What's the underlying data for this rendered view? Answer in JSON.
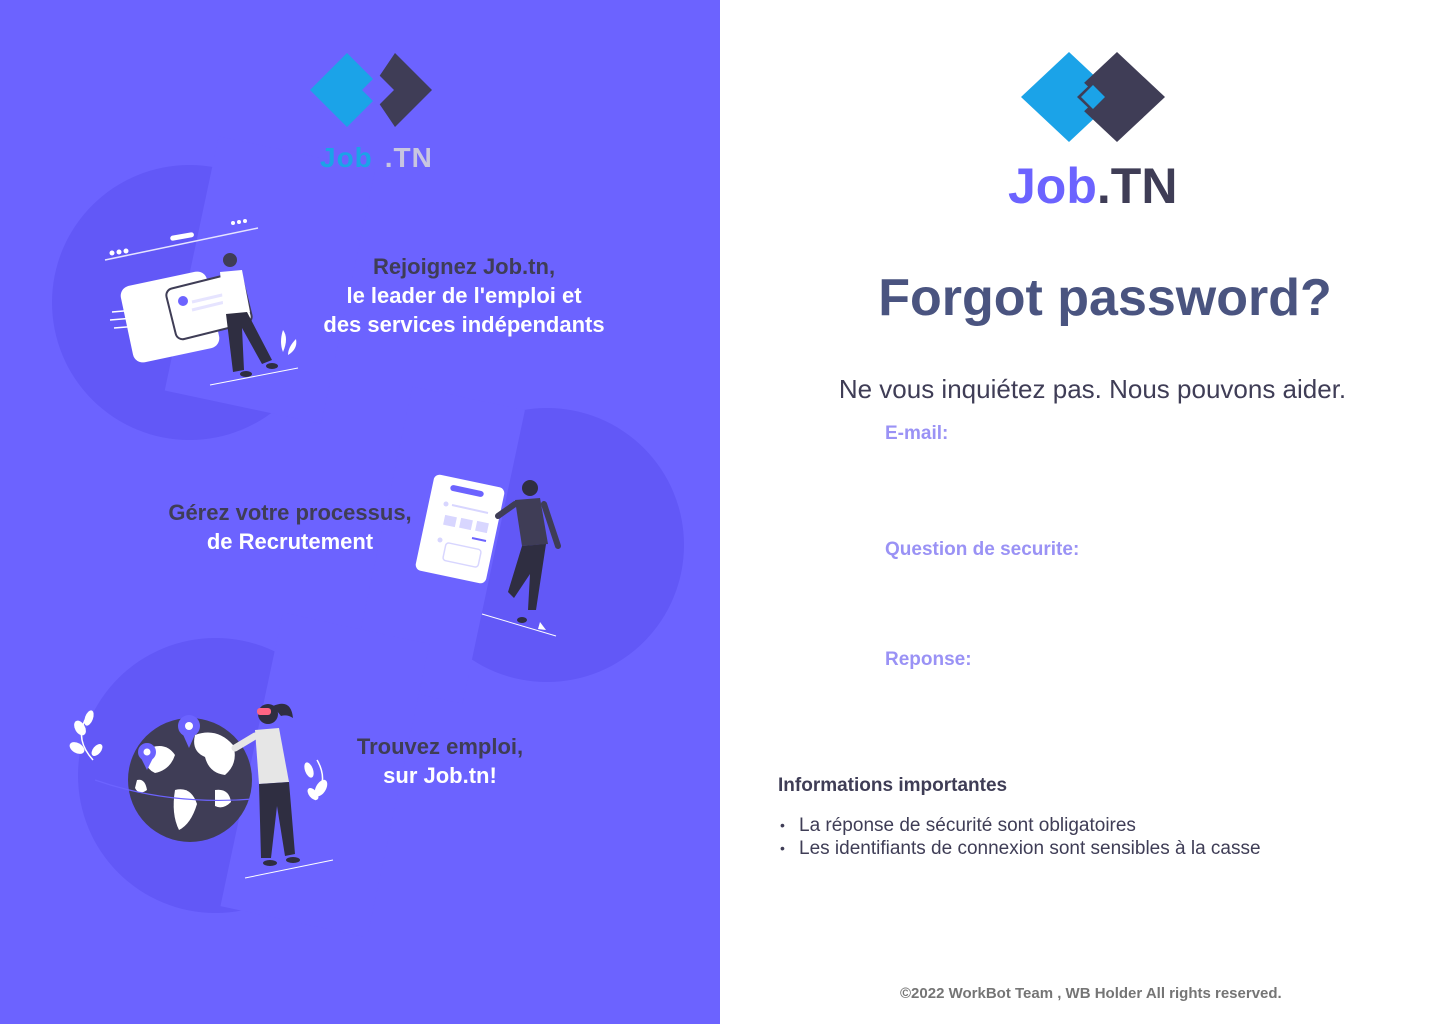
{
  "brand": {
    "name_part1": "Job",
    "name_part2": ".TN",
    "colors": {
      "accent": "#6c63ff",
      "blue": "#1ba3e8",
      "dark": "#3f3d56"
    }
  },
  "left_panel": {
    "features": [
      {
        "line1": "Rejoignez Job.tn,",
        "line2": "le leader de l'emploi et",
        "line3": "des services indépendants"
      },
      {
        "line1": "Gérez votre processus,",
        "line2": "de Recrutement"
      },
      {
        "line1": "Trouvez emploi,",
        "line2": "sur Job.tn!"
      }
    ]
  },
  "form": {
    "title": "Forgot password?",
    "subtitle": "Ne vous inquiétez pas. Nous pouvons aider.",
    "email_label": "E-mail:",
    "email_value": "",
    "question_label": "Question de securite:",
    "question_value": "",
    "answer_label": "Reponse:",
    "answer_value": ""
  },
  "info": {
    "title": "Informations importantes",
    "items": [
      "La réponse de sécurité sont obligatoires",
      "Les identifiants de connexion sont sensibles à la casse"
    ]
  },
  "footer": {
    "text": "©2022 WorkBot Team , WB Holder All rights reserved."
  }
}
